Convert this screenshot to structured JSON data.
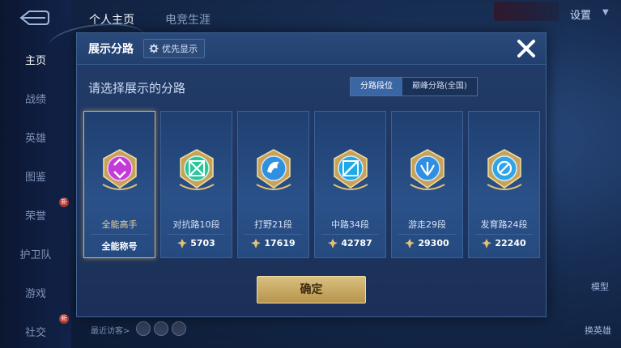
{
  "sidebar": {
    "items": [
      {
        "label": "主页"
      },
      {
        "label": "战绩"
      },
      {
        "label": "英雄"
      },
      {
        "label": "图鉴"
      },
      {
        "label": "荣誉",
        "badge": "新"
      },
      {
        "label": "护卫队"
      },
      {
        "label": "游戏"
      },
      {
        "label": "社交",
        "badge": "新"
      }
    ]
  },
  "topbar": {
    "tabs": [
      {
        "label": "个人主页"
      },
      {
        "label": "电竞生涯"
      }
    ],
    "settings_label": "设置"
  },
  "right_side": {
    "model_label": "模型",
    "switch_hero_label": "换英雄"
  },
  "recent_visitors_label": "最近访客>",
  "dialog": {
    "title": "展示分路",
    "priority_label": "优先显示",
    "instruction": "请选择展示的分路",
    "toggle": {
      "options": [
        {
          "label": "分路段位"
        },
        {
          "label": "巅峰分路(全国)"
        }
      ],
      "selected": "分路段位"
    },
    "cards": [
      {
        "name": "全能高手",
        "value": "全能称号",
        "emblem": "all-round-emblem-icon",
        "color": "#c23bd6",
        "selected": true
      },
      {
        "name": "对抗路10段",
        "value": "5703",
        "emblem": "clash-lane-emblem-icon",
        "color": "#2ec49a",
        "selected": false
      },
      {
        "name": "打野21段",
        "value": "17619",
        "emblem": "jungle-emblem-icon",
        "color": "#2f8fe0",
        "selected": false
      },
      {
        "name": "中路34段",
        "value": "42787",
        "emblem": "mid-lane-emblem-icon",
        "color": "#1fa9e8",
        "selected": false
      },
      {
        "name": "游走29段",
        "value": "29300",
        "emblem": "roam-emblem-icon",
        "color": "#2f8fe0",
        "selected": false
      },
      {
        "name": "发育路24段",
        "value": "22240",
        "emblem": "farm-lane-emblem-icon",
        "color": "#2fa4e8",
        "selected": false
      }
    ],
    "confirm_label": "确定"
  }
}
